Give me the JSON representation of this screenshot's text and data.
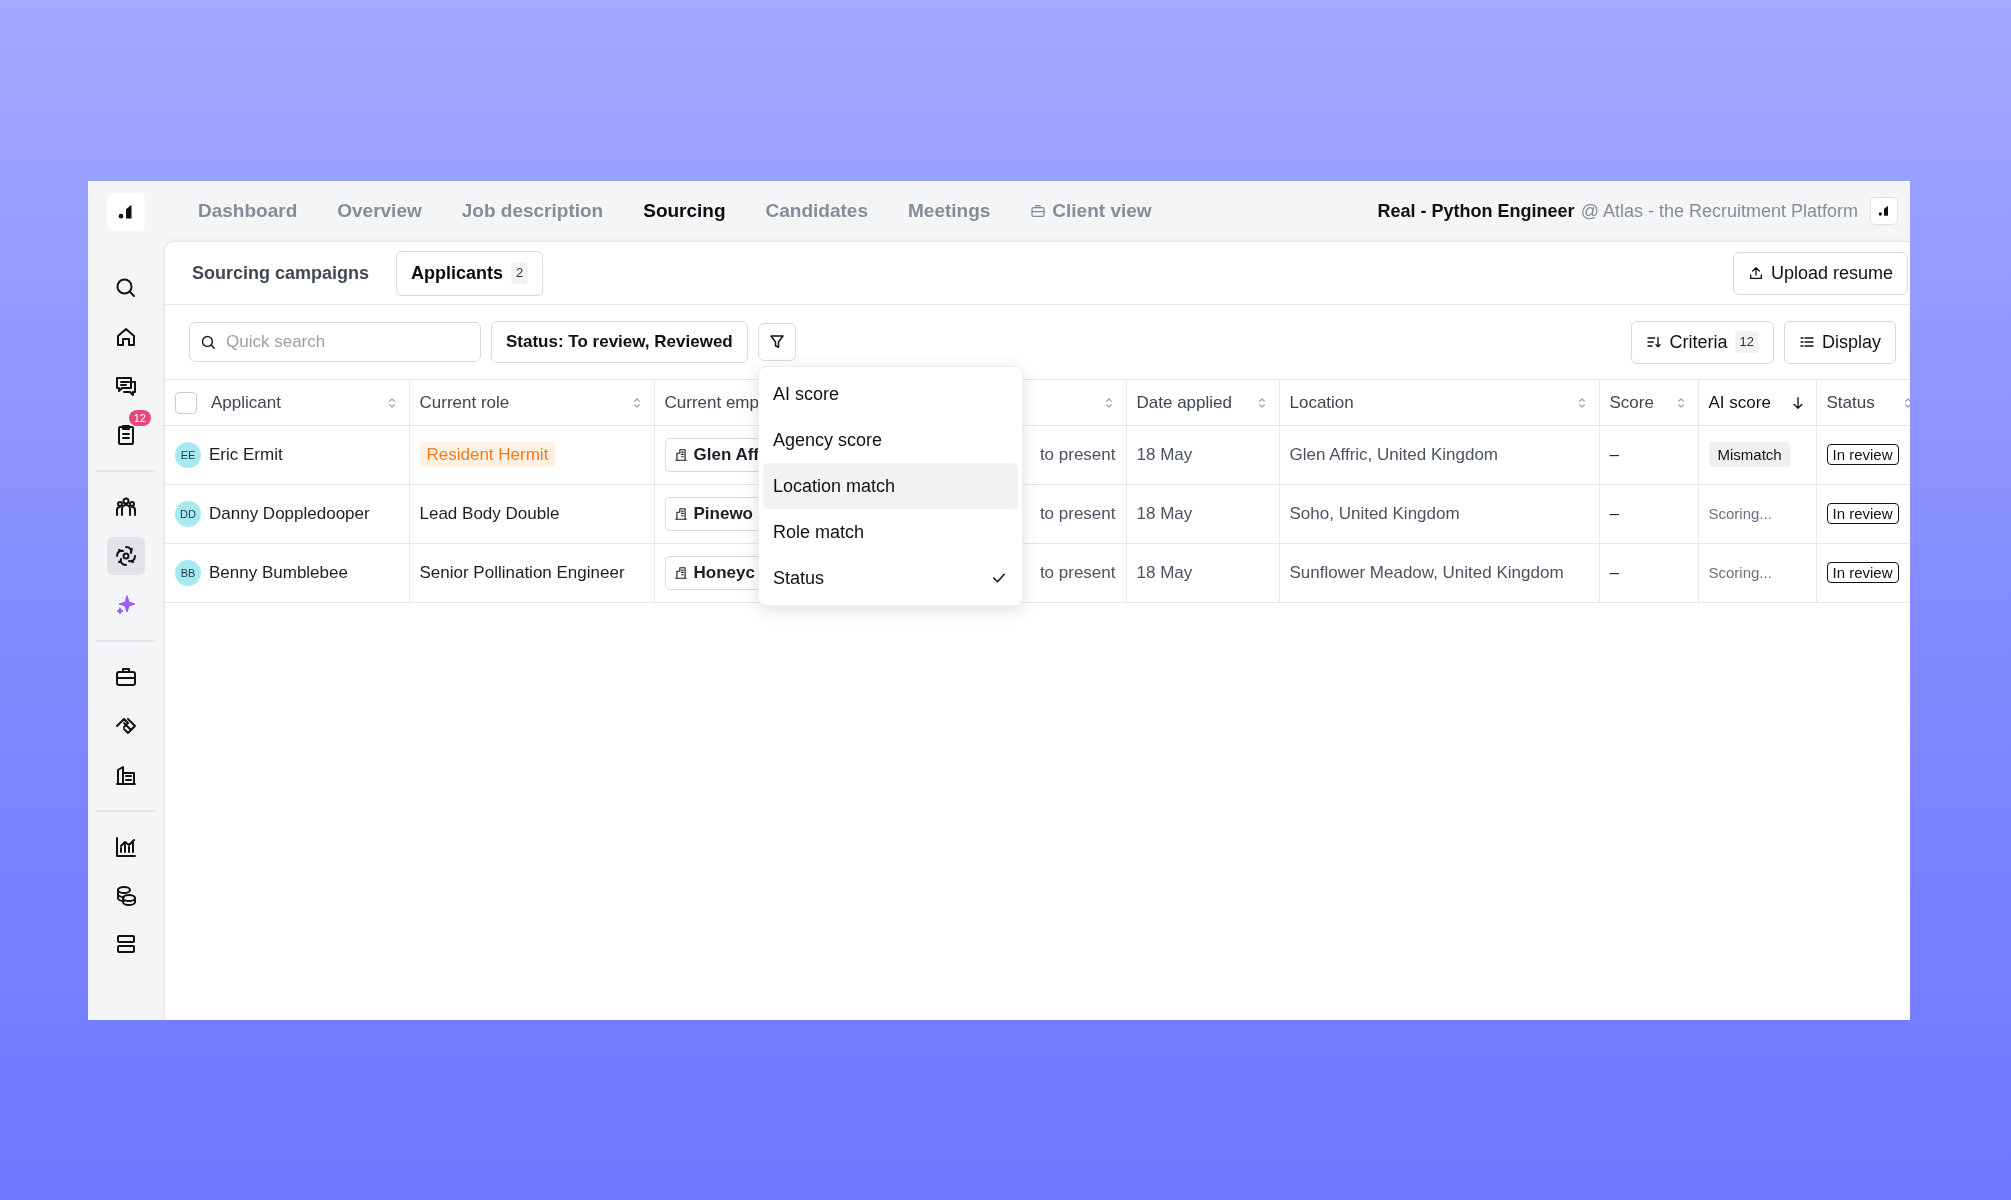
{
  "sidebar": {
    "groups": [
      [
        {
          "selected": false
        },
        {
          "selected": false
        },
        {
          "selected": false
        },
        {
          "selected": false,
          "badge": "12"
        }
      ],
      [
        {
          "selected": false
        },
        {
          "selected": true
        },
        {
          "selected": false
        }
      ],
      [
        {
          "selected": false
        },
        {
          "selected": false
        },
        {
          "selected": false
        }
      ],
      [
        {
          "selected": false
        },
        {
          "selected": false
        },
        {
          "selected": false
        }
      ]
    ]
  },
  "nav": {
    "tabs": [
      {
        "label": "Dashboard",
        "selected": false,
        "icon": false
      },
      {
        "label": "Overview",
        "selected": false,
        "icon": false
      },
      {
        "label": "Job description",
        "selected": false,
        "icon": false
      },
      {
        "label": "Sourcing",
        "selected": true,
        "icon": false
      },
      {
        "label": "Candidates",
        "selected": false,
        "icon": false
      },
      {
        "label": "Meetings",
        "selected": false,
        "icon": false
      },
      {
        "label": "Client view",
        "selected": false,
        "icon": true
      }
    ],
    "job_title": "Real - Python Engineer",
    "organization": "@ Atlas - the Recruitment Platform"
  },
  "subtabs": [
    {
      "label": "Sourcing campaigns",
      "selected": false
    },
    {
      "label": "Applicants",
      "selected": true,
      "count": "2"
    }
  ],
  "upload_button": "Upload resume",
  "toolbar": {
    "search": {
      "placeholder": "Quick search"
    },
    "status_filter": "Status: To review, Reviewed",
    "criteria": {
      "label": "Criteria",
      "count": "12"
    },
    "display": "Display"
  },
  "filter_menu": {
    "items": [
      {
        "label": "AI score",
        "checked": false,
        "highlighted": false
      },
      {
        "label": "Agency score",
        "checked": false,
        "highlighted": false
      },
      {
        "label": "Location match",
        "checked": false,
        "highlighted": true
      },
      {
        "label": "Role match",
        "checked": false,
        "highlighted": false
      },
      {
        "label": "Status",
        "checked": true,
        "highlighted": false
      }
    ]
  },
  "table": {
    "select_all": {
      "checked": false
    },
    "columns": [
      {
        "label": "Applicant",
        "sorted_descending": false
      },
      {
        "label": "Current role",
        "sorted_descending": false
      },
      {
        "label": "Current emp",
        "sorted_descending": false
      },
      {
        "sorted_descending": false
      },
      {
        "label": "Date applied",
        "sorted_descending": false
      },
      {
        "label": "Location",
        "sorted_descending": false
      },
      {
        "label": "Score",
        "sorted_descending": false
      },
      {
        "label": "AI score",
        "sorted_descending": true
      },
      {
        "label": "Status",
        "sorted_descending": false
      }
    ],
    "rows": [
      {
        "initials": "EE",
        "name": "Eric Ermit",
        "role": "Resident Hermit",
        "role_highlighted": true,
        "employer": "Glen Aff",
        "period": "to present",
        "date": "18 May",
        "location": "Glen Affric, United Kingdom",
        "score": "–",
        "ai_score": {
          "text": "Mismatch",
          "kind": "tag"
        },
        "status": "In review"
      },
      {
        "initials": "DD",
        "name": "Danny Doppledooper",
        "role": "Lead Body Double",
        "role_highlighted": false,
        "employer": "Pinewo",
        "period": "to present",
        "date": "18 May",
        "location": "Soho, United Kingdom",
        "score": "–",
        "ai_score": {
          "text": "Scoring...",
          "kind": "pending"
        },
        "status": "In review"
      },
      {
        "initials": "BB",
        "name": "Benny Bumblebee",
        "role": "Senior Pollination Engineer",
        "role_highlighted": false,
        "employer": "Honeyc",
        "period": "to present",
        "date": "18 May",
        "location": "Sunflower Meadow, United Kingdom",
        "score": "–",
        "ai_score": {
          "text": "Scoring...",
          "kind": "pending"
        },
        "status": "In review"
      }
    ]
  }
}
